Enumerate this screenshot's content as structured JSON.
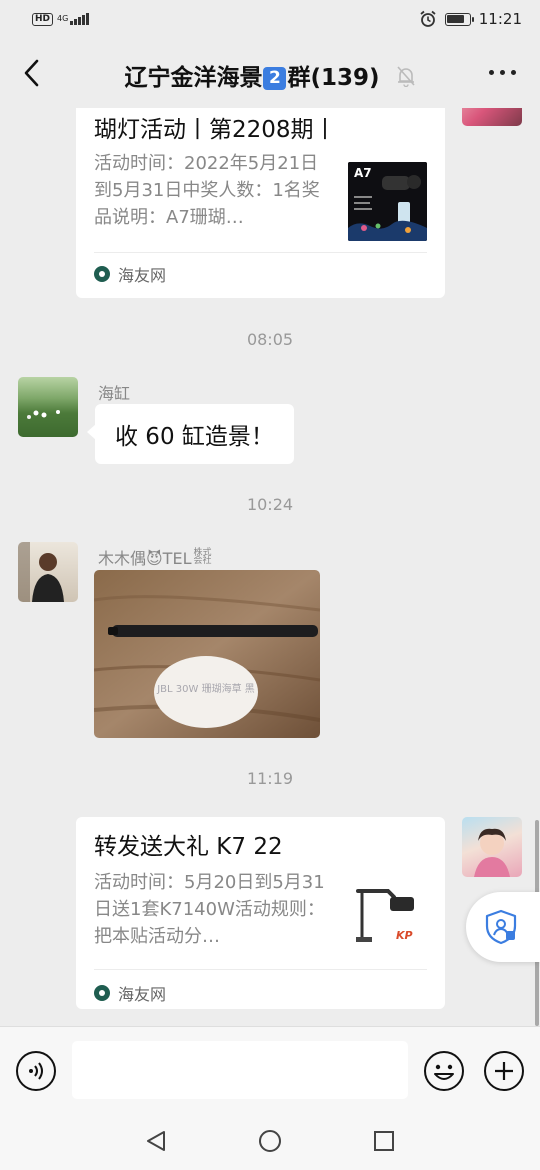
{
  "status_bar": {
    "hd": "HD",
    "network": "4G",
    "time": "11:21",
    "battery_level": 0.8
  },
  "title_bar": {
    "title_prefix": "辽宁金洋海景",
    "title_tag": "2",
    "title_suffix": "群(139)"
  },
  "messages": {
    "card1": {
      "title": "瑚灯活动丨第2208期丨",
      "description": "活动时间：2022年5月21日到5月31日中奖人数：1名奖品说明：A7珊瑚…",
      "thumb_text": "A7",
      "source": "海友网"
    },
    "time1": "08:05",
    "msg1": {
      "sender": "海缸",
      "text": "收 60 缸造景！"
    },
    "time2": "10:24",
    "msg2": {
      "sender": "木木偶😈TEL",
      "sender_tail": "株式会社",
      "photo_text": "JBL 30W 珊瑚海草 黑"
    },
    "time3": "11:19",
    "card2": {
      "title": "转发送大礼 K7 22",
      "description": "活动时间：5月20日到5月31日送1套K7140W活动规则：把本贴活动分…",
      "thumb_text": "KP",
      "source": "海友网"
    }
  },
  "colors": {
    "background": "#ededed",
    "bubble": "#ffffff",
    "title_tag": "#3b7de0",
    "shield": "#3b7de0"
  }
}
